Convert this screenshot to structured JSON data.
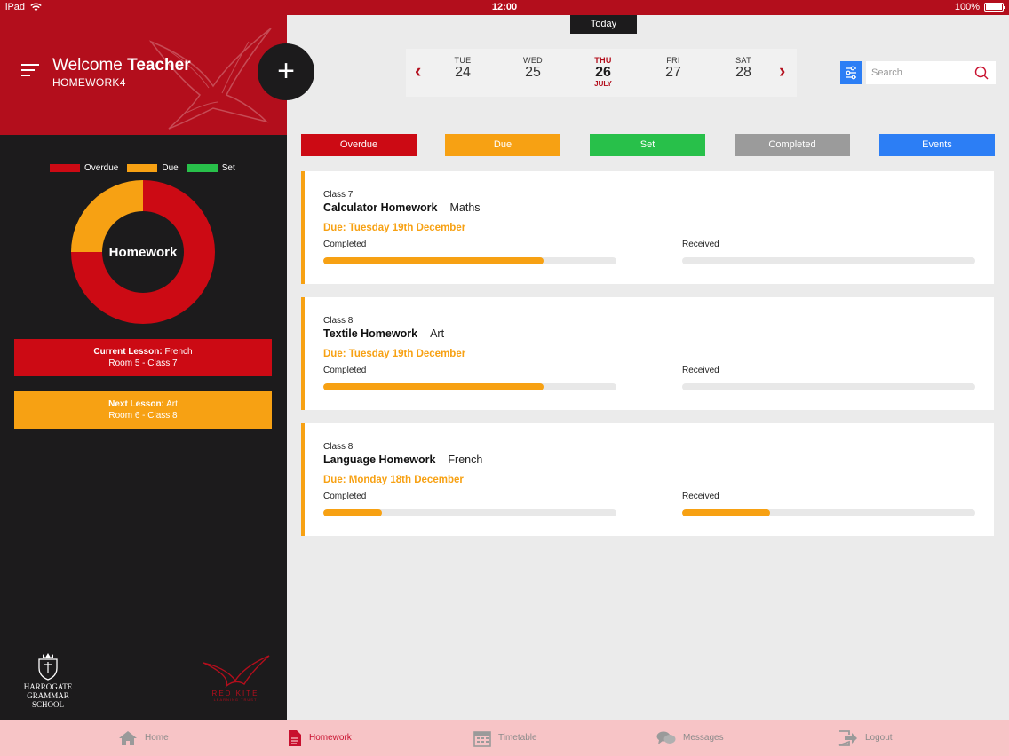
{
  "status_bar": {
    "device": "iPad",
    "time": "12:00",
    "battery": "100%"
  },
  "header": {
    "welcome_prefix": "Welcome",
    "welcome_name": "Teacher",
    "user_code": "HOMEWORK4",
    "add_label": "+"
  },
  "legend": [
    {
      "label": "Overdue",
      "color": "#cc0a14"
    },
    {
      "label": "Due",
      "color": "#f7a113"
    },
    {
      "label": "Set",
      "color": "#28c04a"
    }
  ],
  "chart_data": {
    "type": "pie",
    "title": "Homework",
    "categories": [
      "Overdue",
      "Due",
      "Set"
    ],
    "values": [
      75,
      25,
      0
    ],
    "colors": [
      "#cc0a14",
      "#f7a113",
      "#28c04a"
    ]
  },
  "lessons": {
    "current": {
      "label": "Current Lesson:",
      "subject": "French",
      "room": "Room 5 - Class 7"
    },
    "next": {
      "label": "Next Lesson:",
      "subject": "Art",
      "room": "Room 6 - Class 8"
    }
  },
  "logos": {
    "school_line1": "HARROGATE",
    "school_line2": "GRAMMAR SCHOOL",
    "trust_name": "RED KITE",
    "trust_sub": "LEARNING TRUST"
  },
  "calendar": {
    "today_label": "Today",
    "days": [
      {
        "name": "TUE",
        "date": "24"
      },
      {
        "name": "WED",
        "date": "25"
      },
      {
        "name": "THU",
        "date": "26",
        "month": "JULY",
        "active": true
      },
      {
        "name": "FRI",
        "date": "27"
      },
      {
        "name": "SAT",
        "date": "28"
      }
    ]
  },
  "search": {
    "placeholder": "Search"
  },
  "filters": [
    {
      "label": "Overdue",
      "color": "#cc0a14"
    },
    {
      "label": "Due",
      "color": "#f7a113"
    },
    {
      "label": "Set",
      "color": "#28c04a"
    },
    {
      "label": "Completed",
      "color": "#9b9b9b"
    },
    {
      "label": "Events",
      "color": "#2c7ef5"
    }
  ],
  "homework": [
    {
      "class": "Class 7",
      "title": "Calculator Homework",
      "subject": "Maths",
      "due": "Due: Tuesday 19th December",
      "completed_label": "Completed",
      "received_label": "Received",
      "completed": 0.75,
      "received": 0
    },
    {
      "class": "Class 8",
      "title": "Textile Homework",
      "subject": "Art",
      "due": "Due: Tuesday 19th December",
      "completed_label": "Completed",
      "received_label": "Received",
      "completed": 0.75,
      "received": 0
    },
    {
      "class": "Class 8",
      "title": "Language Homework",
      "subject": "French",
      "due": "Due: Monday 18th December",
      "completed_label": "Completed",
      "received_label": "Received",
      "completed": 0.2,
      "received": 0.3
    }
  ],
  "tabs": [
    {
      "label": "Home",
      "icon": "home-icon"
    },
    {
      "label": "Homework",
      "icon": "document-icon",
      "active": true
    },
    {
      "label": "Timetable",
      "icon": "calendar-icon"
    },
    {
      "label": "Messages",
      "icon": "chat-icon"
    },
    {
      "label": "Logout",
      "icon": "logout-icon"
    }
  ]
}
